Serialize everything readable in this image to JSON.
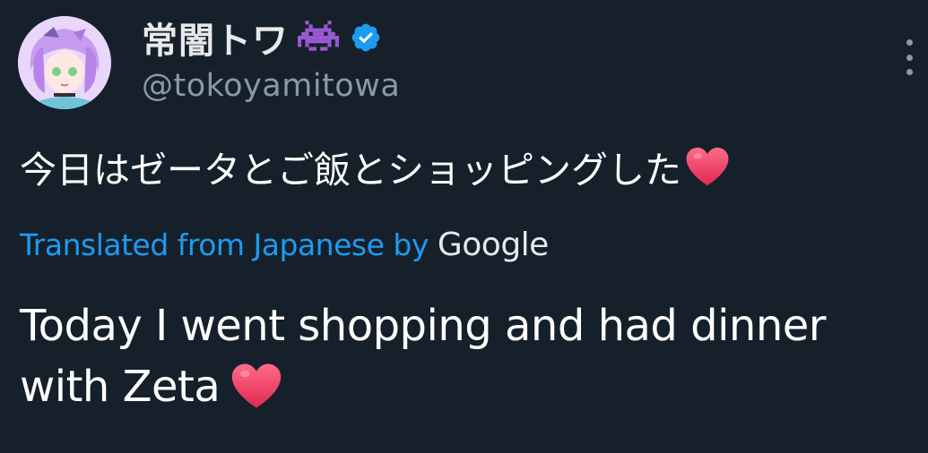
{
  "user": {
    "display_name": "常闇トワ",
    "handle": "@tokoyamitowa",
    "verified": true,
    "name_emoji": "space-invader-icon"
  },
  "tweet": {
    "original_text": "今日はゼータとご飯とショッピングした",
    "translation_label": "Translated from Japanese by",
    "translation_provider": "Google",
    "translated_text_line1": "Today I went shopping and had dinner",
    "translated_text_line2": "with Zeta"
  },
  "colors": {
    "background": "#15202b",
    "link": "#1d9bf0",
    "verified": "#1d9bf0",
    "muted": "#8b98a5",
    "emoji_purple": "#9b59d0",
    "heart": "#f2426a"
  }
}
